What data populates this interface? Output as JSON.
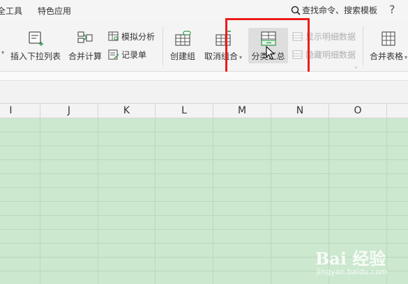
{
  "menubar": {
    "tabs": [
      "全工具",
      "特色应用"
    ],
    "search_label": "查找命令、搜索模板",
    "help_label": "?"
  },
  "ribbon": {
    "insert_dropdown_list": "插入下拉列表",
    "consolidate": "合并计算",
    "simulation_analysis": "模拟分析",
    "record_form": "记录单",
    "create_group": "创建组",
    "ungroup": "取消组合",
    "subtotal": "分类汇总",
    "show_detail": "显示明细数据",
    "hide_detail": "隐藏明细数据",
    "merge_table": "合并表格"
  },
  "columns": [
    "I",
    "J",
    "K",
    "L",
    "M",
    "N",
    "O"
  ],
  "watermark": {
    "brand": "Bai 经验",
    "url": "jingyan.baidu.com"
  },
  "colors": {
    "grid_fill": "#cce8cf",
    "highlight_box": "#ee1b1b"
  }
}
